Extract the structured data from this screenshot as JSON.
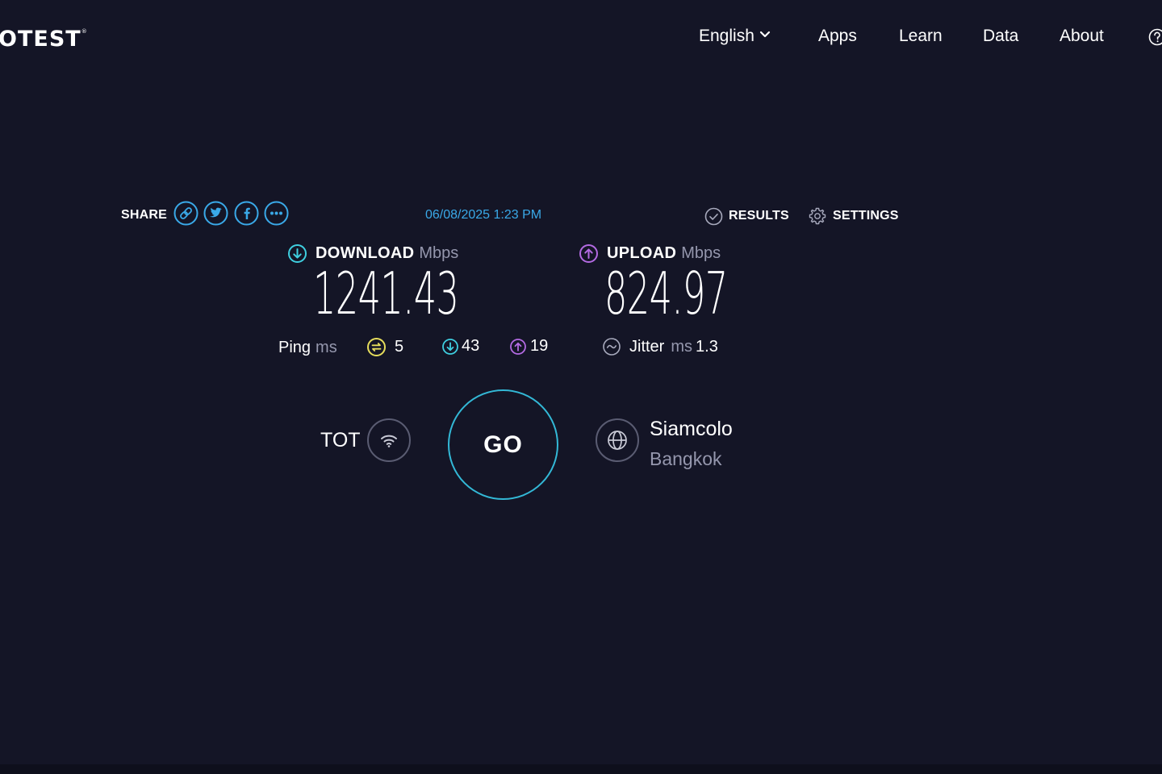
{
  "header": {
    "logo_text": "OTEST",
    "logo_mark": "®",
    "nav": {
      "language": "English",
      "apps": "Apps",
      "learn": "Learn",
      "data": "Data",
      "about": "About"
    }
  },
  "share": {
    "label": "SHARE",
    "buttons": [
      "link-icon",
      "twitter-icon",
      "facebook-icon",
      "more-icon"
    ]
  },
  "test": {
    "timestamp": "06/08/2025 1:23 PM",
    "results_label": "RESULTS",
    "settings_label": "SETTINGS"
  },
  "download": {
    "name": "DOWNLOAD",
    "unit": "Mbps",
    "value": "1241.43"
  },
  "upload": {
    "name": "UPLOAD",
    "unit": "Mbps",
    "value": "824.97"
  },
  "ping": {
    "label": "Ping",
    "unit": "ms",
    "idle": "5",
    "download": "43",
    "upload": "19"
  },
  "jitter": {
    "label": "Jitter",
    "unit": "ms",
    "value": "1.3"
  },
  "provider": {
    "name": "TOT"
  },
  "go_label": "GO",
  "server": {
    "name": "Siamcolo",
    "city": "Bangkok"
  },
  "colors": {
    "background": "#141526",
    "accent_blue": "#3aa9e8",
    "download_cyan": "#3fcfe0",
    "upload_purple": "#b36ae2",
    "ping_yellow": "#e7de5c",
    "go_ring": "#33b8d6",
    "muted": "#9597ad"
  }
}
